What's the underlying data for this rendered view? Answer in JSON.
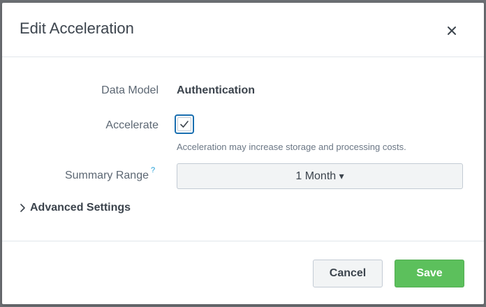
{
  "modal": {
    "title": "Edit Acceleration",
    "close_icon": "close-icon"
  },
  "form": {
    "data_model": {
      "label": "Data Model",
      "value": "Authentication"
    },
    "accelerate": {
      "label": "Accelerate",
      "checked": true,
      "help_text": "Acceleration may increase storage and processing costs."
    },
    "summary_range": {
      "label": "Summary Range",
      "help_marker": "?",
      "selected": "1 Month",
      "caret": "▾"
    },
    "advanced_settings": {
      "label": "Advanced Settings",
      "expanded": false
    }
  },
  "footer": {
    "cancel_label": "Cancel",
    "save_label": "Save"
  },
  "colors": {
    "accent_blue": "#1a6fb0",
    "save_green": "#5cc05c",
    "help_blue": "#1a9cd6"
  }
}
